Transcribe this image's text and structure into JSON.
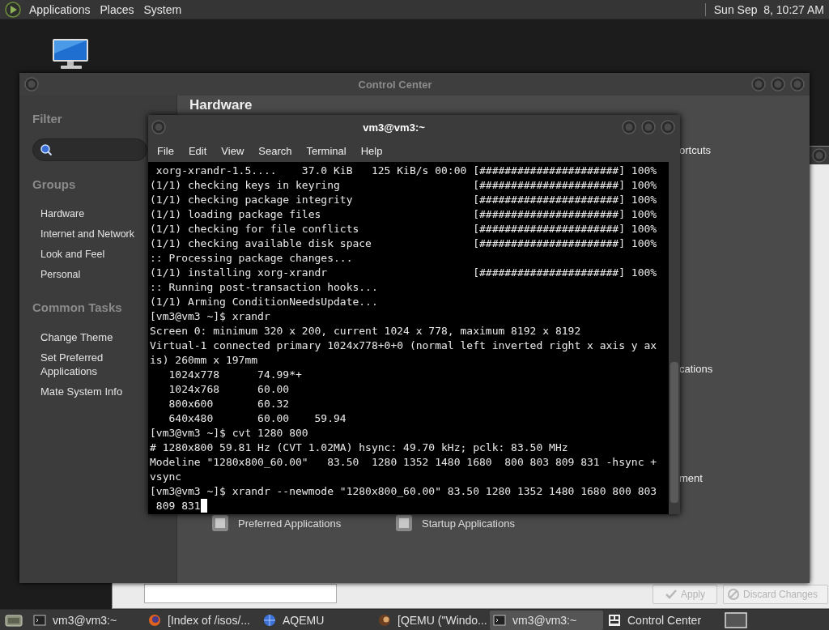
{
  "top_panel": {
    "menus": [
      "Applications",
      "Places",
      "System"
    ],
    "clock": "Sun Sep  8, 10:27 AM"
  },
  "back_window": {
    "buttons": [
      {
        "label": "Apply",
        "kind": "apply",
        "disabled": true
      },
      {
        "label": "Discard Changes",
        "kind": "discard",
        "disabled": true
      }
    ]
  },
  "control_center": {
    "title": "Control Center",
    "filter_heading": "Filter",
    "groups_heading": "Groups",
    "groups": [
      "Hardware",
      "Internet and Network",
      "Look and Feel",
      "Personal"
    ],
    "tasks_heading": "Common Tasks",
    "tasks": [
      "Change Theme",
      "Set Preferred Applications",
      "Mate System Info"
    ],
    "section_title": "Hardware",
    "item_fragments": [
      "ortcuts",
      "cations",
      "ment"
    ],
    "bottom_items": [
      "Preferred Applications",
      "Startup Applications"
    ]
  },
  "terminal": {
    "title": "vm3@vm3:~",
    "menu": [
      "File",
      "Edit",
      "View",
      "Search",
      "Terminal",
      "Help"
    ],
    "lines": [
      {
        "kind": "progress",
        "text": " xorg-xrandr-1.5....    37.0 KiB   125 KiB/s 00:00",
        "bar": "[######################]",
        "percent": "100%"
      },
      {
        "kind": "progress",
        "text": "(1/1) checking keys in keyring",
        "bar": "[######################]",
        "percent": "100%"
      },
      {
        "kind": "progress",
        "text": "(1/1) checking package integrity",
        "bar": "[######################]",
        "percent": "100%"
      },
      {
        "kind": "progress",
        "text": "(1/1) loading package files",
        "bar": "[######################]",
        "percent": "100%"
      },
      {
        "kind": "progress",
        "text": "(1/1) checking for file conflicts",
        "bar": "[######################]",
        "percent": "100%"
      },
      {
        "kind": "progress",
        "text": "(1/1) checking available disk space",
        "bar": "[######################]",
        "percent": "100%"
      },
      {
        "kind": "text",
        "text": ":: Processing package changes..."
      },
      {
        "kind": "progress",
        "text": "(1/1) installing xorg-xrandr",
        "bar": "[######################]",
        "percent": "100%"
      },
      {
        "kind": "text",
        "text": ":: Running post-transaction hooks..."
      },
      {
        "kind": "text",
        "text": "(1/1) Arming ConditionNeedsUpdate..."
      },
      {
        "kind": "text",
        "text": "[vm3@vm3 ~]$ xrandr"
      },
      {
        "kind": "text",
        "text": "Screen 0: minimum 320 x 200, current 1024 x 778, maximum 8192 x 8192"
      },
      {
        "kind": "text",
        "text": "Virtual-1 connected primary 1024x778+0+0 (normal left inverted right x axis y ax"
      },
      {
        "kind": "text",
        "text": "is) 260mm x 197mm"
      },
      {
        "kind": "text",
        "text": "   1024x778      74.99*+"
      },
      {
        "kind": "text",
        "text": "   1024x768      60.00"
      },
      {
        "kind": "text",
        "text": "   800x600       60.32"
      },
      {
        "kind": "text",
        "text": "   640x480       60.00    59.94"
      },
      {
        "kind": "text",
        "text": "[vm3@vm3 ~]$ cvt 1280 800"
      },
      {
        "kind": "text",
        "text": "# 1280x800 59.81 Hz (CVT 1.02MA) hsync: 49.70 kHz; pclk: 83.50 MHz"
      },
      {
        "kind": "text",
        "text": "Modeline \"1280x800_60.00\"   83.50  1280 1352 1480 1680  800 803 809 831 -hsync +"
      },
      {
        "kind": "text",
        "text": "vsync"
      },
      {
        "kind": "text",
        "text": "[vm3@vm3 ~]$ xrandr --newmode \"1280x800_60.00\" 83.50 1280 1352 1480 1680 800 803"
      },
      {
        "kind": "text",
        "text": " 809 831",
        "cursor": true
      }
    ]
  },
  "taskbar": [
    {
      "label": "vm3@vm3:~",
      "kind": "terminal",
      "selected": false
    },
    {
      "label": "[Index of /isos/...",
      "kind": "browser",
      "selected": false
    },
    {
      "label": "AQEMU",
      "kind": "globe",
      "selected": false
    },
    {
      "label": "[QEMU (\"Windo...",
      "kind": "qemu",
      "selected": false
    },
    {
      "label": "vm3@vm3:~",
      "kind": "terminal",
      "selected": true
    },
    {
      "label": "Control Center",
      "kind": "control",
      "selected": false
    }
  ]
}
